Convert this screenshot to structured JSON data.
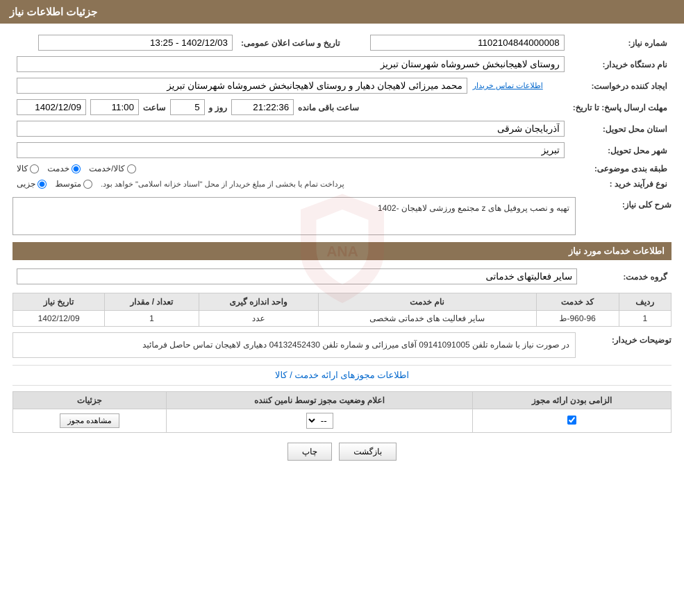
{
  "page": {
    "title": "جزئیات اطلاعات نیاز"
  },
  "header": {
    "title": "جزئیات اطلاعات نیاز"
  },
  "fields": {
    "need_number_label": "شماره نیاز:",
    "need_number_value": "1102104844000008",
    "announce_date_label": "تاریخ و ساعت اعلان عمومی:",
    "announce_date_value": "1402/12/03 - 13:25",
    "buyer_name_label": "نام دستگاه خریدار:",
    "buyer_name_value": "روستای لاهیجانبخش خسروشاه شهرستان تبریز",
    "requester_label": "ایجاد کننده درخواست:",
    "requester_value": "محمد میرزائی لاهیجان دهیار و روستای لاهیجانبخش خسروشاه شهرستان تبریز",
    "contact_link": "اطلاعات تماس خریدار",
    "reply_deadline_label": "مهلت ارسال پاسخ: تا تاریخ:",
    "reply_date": "1402/12/09",
    "reply_time_label": "ساعت",
    "reply_time": "11:00",
    "reply_day_label": "روز و",
    "reply_days": "5",
    "reply_remaining_label": "ساعت باقی مانده",
    "reply_remaining": "21:22:36",
    "province_label": "استان محل تحویل:",
    "province_value": "آذربایجان شرقی",
    "city_label": "شهر محل تحویل:",
    "city_value": "تبریز",
    "category_label": "طبقه بندی موضوعی:",
    "category_options": [
      "کالا",
      "خدمت",
      "کالا/خدمت"
    ],
    "category_selected": "خدمت",
    "purchase_type_label": "نوع فرآیند خرید :",
    "purchase_type_options": [
      "جزیی",
      "متوسط"
    ],
    "purchase_type_note": "پرداخت تمام یا بخشی از مبلغ خریدار از محل \"اسناد خزانه اسلامی\" خواهد بود.",
    "description_label": "شرح کلی نیاز:",
    "description_value": "تهیه و نصب پروفیل های z  مجتمع ورزشی لاهیجان -1402",
    "service_info_label": "اطلاعات خدمات مورد نیاز",
    "service_group_label": "گروه خدمت:",
    "service_group_value": "سایر فعالیتهای خدماتی",
    "table": {
      "headers": [
        "ردیف",
        "کد خدمت",
        "نام خدمت",
        "واحد اندازه گیری",
        "تعداد / مقدار",
        "تاریخ نیاز"
      ],
      "rows": [
        {
          "row": "1",
          "code": "960-96-ط",
          "name": "سایر فعالیت های خدماتی شخصی",
          "unit": "عدد",
          "qty": "1",
          "date": "1402/12/09"
        }
      ]
    },
    "buyer_notes_label": "توضیحات خریدار:",
    "buyer_notes_value": "در صورت نیاز با شماره تلفن 09141091005 آقای میرزائی  و  شماره تلفن 04132452430 دهیاری لاهیجان تماس حاصل فرمائید",
    "permissions_link": "اطلاعات مجوزهای ارائه خدمت / کالا",
    "permissions_table": {
      "headers": [
        "الزامی بودن ارائه مجوز",
        "اعلام وضعیت مجوز توسط نامین کننده",
        "جزئیات"
      ],
      "rows": [
        {
          "required": true,
          "status": "--",
          "details": "مشاهده مجوز"
        }
      ]
    }
  },
  "buttons": {
    "print": "چاپ",
    "back": "بازگشت",
    "view_permit": "مشاهده مجوز"
  }
}
